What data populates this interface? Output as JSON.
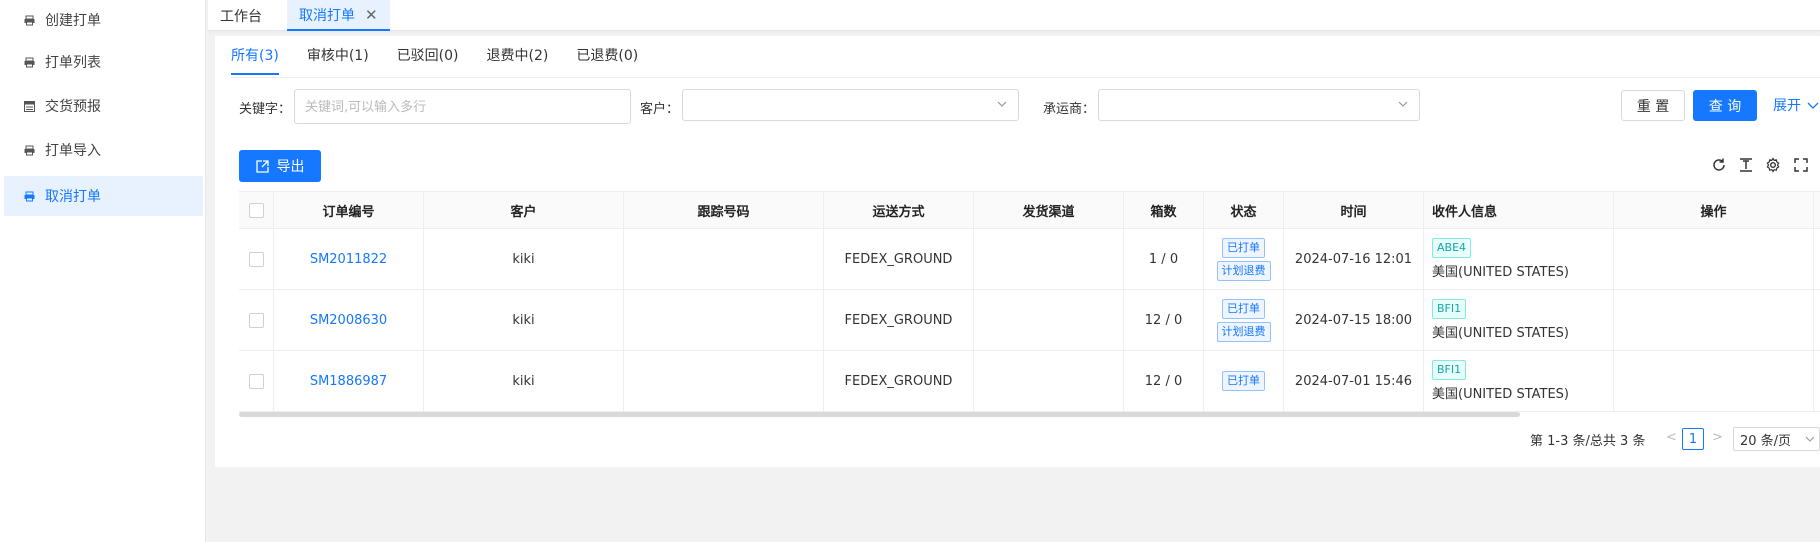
{
  "sidebar": {
    "items": [
      {
        "label": "创建打单",
        "icon": "print-icon",
        "active": false
      },
      {
        "label": "打单列表",
        "icon": "print-icon",
        "active": false
      },
      {
        "label": "交货预报",
        "icon": "form-icon",
        "active": false
      },
      {
        "label": "打单导入",
        "icon": "print-icon",
        "active": false
      },
      {
        "label": "取消打单",
        "icon": "print-icon",
        "active": true
      }
    ]
  },
  "page_tabs": [
    {
      "label": "工作台",
      "active": false
    },
    {
      "label": "取消打单",
      "active": true,
      "closable": true
    }
  ],
  "status_tabs": [
    {
      "label": "所有(3)",
      "active": true
    },
    {
      "label": "审核中(1)",
      "active": false
    },
    {
      "label": "已驳回(0)",
      "active": false
    },
    {
      "label": "退费中(2)",
      "active": false
    },
    {
      "label": "已退费(0)",
      "active": false
    }
  ],
  "filters": {
    "keyword_label": "关键字：",
    "keyword_placeholder": "关键词,可以输入多行",
    "customer_label": "客户：",
    "carrier_label": "承运商：",
    "reset_label": "重 置",
    "search_label": "查 询",
    "expand_label": "展开"
  },
  "toolbar": {
    "export_label": "导出",
    "icons": [
      "refresh-icon",
      "column-height-icon",
      "settings-icon",
      "fullscreen-icon"
    ]
  },
  "table": {
    "columns": [
      "订单编号",
      "客户",
      "跟踪号码",
      "运送方式",
      "发货渠道",
      "箱数",
      "状态",
      "时间",
      "收件人信息",
      "操作"
    ],
    "rows": [
      {
        "order_no": "SM2011822",
        "customer": "kiki",
        "tracking": "",
        "shipping": "FEDEX_GROUND",
        "channel": "",
        "boxes": "1 / 0",
        "status": [
          "已打单",
          "计划退费"
        ],
        "time": "2024-07-16 12:01",
        "recv_tag": "ABE4",
        "recv_country": "美国(UNITED STATES)",
        "action": ""
      },
      {
        "order_no": "SM2008630",
        "customer": "kiki",
        "tracking": "",
        "shipping": "FEDEX_GROUND",
        "channel": "",
        "boxes": "12 / 0",
        "status": [
          "已打单",
          "计划退费"
        ],
        "time": "2024-07-15 18:00",
        "recv_tag": "BFI1",
        "recv_country": "美国(UNITED STATES)",
        "action": ""
      },
      {
        "order_no": "SM1886987",
        "customer": "kiki",
        "tracking": "",
        "shipping": "FEDEX_GROUND",
        "channel": "",
        "boxes": "12 / 0",
        "status": [
          "已打单"
        ],
        "time": "2024-07-01 15:46",
        "recv_tag": "BFI1",
        "recv_country": "美国(UNITED STATES)",
        "action": ""
      }
    ]
  },
  "pagination": {
    "total_text": "第 1-3 条/总共 3 条",
    "prev": "<",
    "current_page": "1",
    "next": ">",
    "page_size": "20 条/页"
  },
  "colors": {
    "accent": "#1677ff",
    "tag_cyan": "#13a8a8"
  }
}
